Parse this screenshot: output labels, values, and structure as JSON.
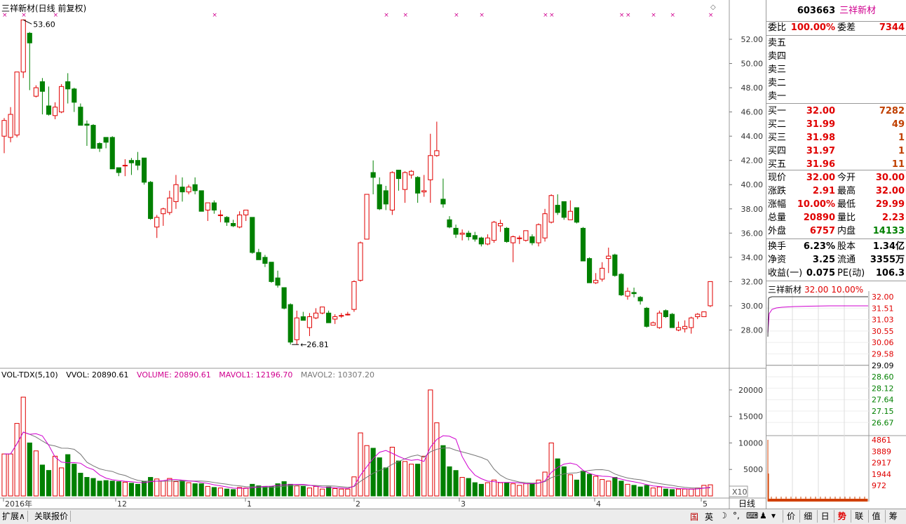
{
  "stock": {
    "code": "603663",
    "name": "三祥新材",
    "chart_title": "三祥新材(日线 前复权)",
    "period_label": "日线",
    "mult_label": "X10"
  },
  "chart_data": {
    "type": "candlestick",
    "price_axis": {
      "min": 26,
      "max": 53.6,
      "ticks": [
        "52.00",
        "50.00",
        "48.00",
        "46.00",
        "44.00",
        "42.00",
        "40.00",
        "38.00",
        "36.00",
        "34.00",
        "32.00",
        "30.00",
        "28.00"
      ]
    },
    "annotations": {
      "high": "53.60",
      "low": "26.81"
    },
    "x_labels": [
      "2016年",
      "12",
      "1",
      "2",
      "3",
      "4",
      "5"
    ],
    "candles": [
      [
        44.0,
        45.3,
        42.6,
        45.5
      ],
      [
        43.9,
        45.8,
        43.5,
        46.4
      ],
      [
        44.1,
        49.3,
        43.9,
        49.3
      ],
      [
        49.3,
        53.6,
        48.8,
        53.6
      ],
      [
        52.5,
        51.7,
        47.8,
        52.6
      ],
      [
        47.3,
        48.0,
        47.2,
        48.2
      ],
      [
        48.5,
        47.7,
        45.8,
        48.8
      ],
      [
        46.5,
        45.8,
        45.7,
        48.1
      ],
      [
        45.7,
        46.4,
        45.4,
        46.8
      ],
      [
        46.0,
        48.1,
        45.9,
        48.3
      ],
      [
        48.5,
        47.9,
        46.7,
        49.2
      ],
      [
        47.9,
        46.8,
        46.0,
        48.0
      ],
      [
        46.4,
        44.9,
        44.9,
        46.7
      ],
      [
        45.0,
        44.9,
        43.2,
        45.3
      ],
      [
        44.9,
        43.0,
        43.0,
        45.0
      ],
      [
        43.4,
        43.0,
        42.7,
        43.5
      ],
      [
        43.9,
        43.5,
        43.0,
        43.5
      ],
      [
        43.9,
        41.3,
        41.3,
        44.0
      ],
      [
        41.4,
        41.0,
        40.7,
        41.4
      ],
      [
        41.6,
        41.6,
        40.7,
        42.1
      ],
      [
        42.0,
        41.8,
        40.8,
        42.2
      ],
      [
        42.0,
        41.6,
        41.2,
        42.7
      ],
      [
        42.2,
        40.2,
        40.0,
        42.2
      ],
      [
        40.2,
        37.2,
        37.1,
        40.3
      ],
      [
        36.5,
        37.3,
        35.6,
        37.5
      ],
      [
        37.6,
        38.0,
        36.6,
        38.1
      ],
      [
        37.7,
        38.9,
        37.5,
        39.5
      ],
      [
        38.6,
        40.0,
        38.0,
        40.8
      ],
      [
        39.8,
        39.4,
        38.6,
        40.6
      ],
      [
        39.4,
        39.8,
        39.2,
        40.0
      ],
      [
        40.0,
        39.5,
        39.2,
        40.6
      ],
      [
        39.5,
        37.8,
        37.8,
        39.5
      ],
      [
        37.9,
        38.5,
        37.0,
        38.5
      ],
      [
        38.5,
        37.9,
        37.6,
        38.7
      ],
      [
        37.5,
        37.5,
        36.9,
        37.9
      ],
      [
        37.3,
        36.9,
        36.6,
        37.4
      ],
      [
        36.8,
        36.6,
        36.5,
        37.1
      ],
      [
        36.5,
        37.5,
        36.4,
        37.8
      ],
      [
        37.5,
        37.9,
        37.0,
        37.9
      ],
      [
        37.3,
        34.4,
        34.3,
        37.3
      ],
      [
        34.4,
        33.8,
        33.8,
        34.7
      ],
      [
        34.0,
        33.5,
        33.2,
        34.2
      ],
      [
        33.6,
        32.0,
        31.9,
        33.6
      ],
      [
        32.3,
        31.7,
        31.5,
        32.9
      ],
      [
        31.5,
        29.8,
        29.7,
        31.5
      ],
      [
        30.1,
        27.0,
        26.8,
        30.2
      ],
      [
        27.2,
        29.0,
        26.8,
        29.6
      ],
      [
        29.1,
        28.8,
        28.8,
        29.5
      ],
      [
        28.2,
        29.1,
        27.5,
        29.4
      ],
      [
        29.0,
        29.4,
        28.9,
        29.8
      ],
      [
        29.4,
        29.9,
        29.3,
        29.9
      ],
      [
        29.4,
        28.6,
        28.6,
        29.6
      ],
      [
        28.9,
        29.1,
        28.5,
        29.3
      ],
      [
        29.2,
        29.2,
        29.0,
        29.4
      ],
      [
        29.3,
        29.3,
        29.2,
        29.5
      ],
      [
        29.7,
        32.0,
        29.5,
        32.1
      ],
      [
        32.1,
        35.2,
        32.0,
        35.3
      ],
      [
        35.5,
        39.2,
        35.5,
        39.2
      ],
      [
        41.0,
        40.6,
        39.2,
        42.0
      ],
      [
        40.0,
        38.0,
        37.9,
        40.6
      ],
      [
        39.5,
        38.4,
        37.9,
        39.9
      ],
      [
        37.9,
        41.0,
        37.5,
        41.1
      ],
      [
        41.2,
        40.5,
        39.5,
        41.2
      ],
      [
        39.6,
        41.0,
        38.5,
        41.1
      ],
      [
        40.8,
        41.1,
        40.5,
        41.2
      ],
      [
        40.6,
        39.3,
        38.5,
        40.7
      ],
      [
        39.4,
        39.5,
        39.0,
        40.8
      ],
      [
        40.4,
        42.4,
        38.5,
        44.2
      ],
      [
        42.4,
        42.8,
        42.3,
        45.2
      ],
      [
        38.8,
        38.4,
        38.1,
        40.5
      ],
      [
        37.1,
        36.5,
        36.4,
        37.4
      ],
      [
        36.4,
        35.9,
        35.6,
        36.7
      ],
      [
        35.9,
        36.0,
        35.4,
        36.3
      ],
      [
        36.0,
        35.7,
        35.4,
        36.2
      ],
      [
        35.8,
        35.5,
        35.3,
        36.1
      ],
      [
        35.6,
        35.1,
        34.9,
        35.7
      ],
      [
        35.1,
        35.6,
        35.0,
        35.9
      ],
      [
        35.4,
        36.9,
        35.2,
        37.0
      ],
      [
        36.6,
        36.8,
        36.1,
        37.1
      ],
      [
        36.4,
        35.3,
        35.2,
        36.5
      ],
      [
        35.2,
        35.7,
        33.6,
        35.8
      ],
      [
        35.6,
        35.6,
        35.1,
        35.8
      ],
      [
        35.4,
        36.2,
        35.3,
        36.2
      ],
      [
        35.7,
        35.2,
        35.0,
        35.9
      ],
      [
        35.2,
        36.7,
        34.9,
        36.8
      ],
      [
        35.6,
        37.6,
        35.3,
        38.0
      ],
      [
        36.9,
        39.1,
        36.8,
        39.2
      ],
      [
        38.3,
        37.7,
        37.5,
        39.2
      ],
      [
        38.6,
        37.3,
        37.1,
        38.6
      ],
      [
        37.1,
        37.8,
        37.1,
        38.7
      ],
      [
        38.1,
        36.9,
        36.8,
        38.1
      ],
      [
        36.4,
        33.7,
        33.7,
        36.5
      ],
      [
        33.9,
        31.9,
        31.9,
        34.0
      ],
      [
        31.9,
        32.1,
        31.8,
        32.7
      ],
      [
        32.2,
        33.1,
        32.0,
        33.6
      ],
      [
        33.9,
        34.1,
        32.7,
        34.8
      ],
      [
        34.2,
        32.5,
        32.4,
        34.3
      ],
      [
        32.6,
        30.9,
        30.8,
        32.7
      ],
      [
        30.8,
        31.2,
        30.5,
        31.5
      ],
      [
        31.1,
        31.0,
        30.7,
        31.5
      ],
      [
        30.7,
        30.4,
        30.1,
        30.8
      ],
      [
        29.8,
        28.3,
        28.2,
        29.9
      ],
      [
        28.4,
        28.6,
        28.4,
        28.7
      ],
      [
        28.2,
        29.4,
        28.1,
        29.6
      ],
      [
        29.6,
        29.1,
        29.0,
        29.7
      ],
      [
        29.3,
        28.2,
        28.2,
        29.4
      ],
      [
        28.0,
        28.2,
        27.9,
        28.7
      ],
      [
        28.1,
        28.3,
        27.8,
        28.8
      ],
      [
        28.2,
        29.0,
        27.7,
        29.1
      ],
      [
        29.1,
        29.3,
        28.9,
        29.4
      ],
      [
        29.1,
        29.5,
        29.2,
        29.5
      ],
      [
        30.0,
        32.0,
        29.9,
        32.0
      ]
    ],
    "volume_axis": {
      "max": 20000,
      "ticks": [
        "20000",
        "15000",
        "10000",
        "5000"
      ]
    },
    "volume": [
      7926,
      7921,
      13684,
      18645,
      10000,
      8500,
      5833,
      4813,
      7500,
      5300,
      7800,
      6000,
      4300,
      3500,
      3300,
      2800,
      2900,
      2800,
      2700,
      2600,
      2400,
      2200,
      2700,
      3500,
      3200,
      2800,
      3300,
      2700,
      2900,
      2500,
      2300,
      2300,
      1800,
      1600,
      1500,
      1300,
      1200,
      1600,
      1500,
      2200,
      1900,
      1800,
      1800,
      2300,
      2700,
      2200,
      1900,
      1800,
      1500,
      1800,
      1300,
      1700,
      1400,
      1300,
      1300,
      3600,
      11900,
      9500,
      9000,
      7200,
      5300,
      9200,
      6600,
      6500,
      6000,
      6000,
      7500,
      20000,
      13800,
      9500,
      5500,
      4800,
      3500,
      3300,
      2500,
      2200,
      2500,
      3000,
      2500,
      2500,
      2300,
      2000,
      2300,
      2400,
      3000,
      4500,
      10000,
      7000,
      5500,
      4000,
      3000,
      4700,
      4100,
      3700,
      3100,
      2800,
      3500,
      2800,
      2200,
      2000,
      1700,
      2000,
      1500,
      1700,
      1300,
      1200,
      1300,
      1300,
      1300,
      1500,
      2000,
      2100
    ],
    "volume_header": {
      "indicator": "VOL-TDX(5,10)",
      "vvol": "VVOL: 20890.61",
      "volume": "VOLUME: 20890.61",
      "mavol1": "MAVOL1: 12196.70",
      "mavol2": "MAVOL2: 10307.20"
    }
  },
  "quote": {
    "weibi": "100.00%",
    "weicha": "7344",
    "sell": [
      {
        "label": "卖五"
      },
      {
        "label": "卖四"
      },
      {
        "label": "卖三"
      },
      {
        "label": "卖二"
      },
      {
        "label": "卖一"
      }
    ],
    "buy": [
      {
        "label": "买一",
        "price": "32.00",
        "vol": "7282"
      },
      {
        "label": "买二",
        "price": "31.99",
        "vol": "49"
      },
      {
        "label": "买三",
        "price": "31.98",
        "vol": "1"
      },
      {
        "label": "买四",
        "price": "31.97",
        "vol": "1"
      },
      {
        "label": "买五",
        "price": "31.96",
        "vol": "11"
      }
    ],
    "stats": [
      {
        "l1": "现价",
        "v1": "32.00",
        "c1": "red",
        "l2": "今开",
        "v2": "30.00",
        "c2": "red"
      },
      {
        "l1": "涨跌",
        "v1": "2.91",
        "c1": "red",
        "l2": "最高",
        "v2": "32.00",
        "c2": "red"
      },
      {
        "l1": "涨幅",
        "v1": "10.00%",
        "c1": "red",
        "l2": "最低",
        "v2": "29.99",
        "c2": "red"
      },
      {
        "l1": "总量",
        "v1": "20890",
        "c1": "red",
        "l2": "量比",
        "v2": "2.23",
        "c2": "red"
      },
      {
        "l1": "外盘",
        "v1": "6757",
        "c1": "red",
        "l2": "内盘",
        "v2": "14133",
        "c2": "grn"
      }
    ],
    "fund": [
      {
        "l1": "换手",
        "v1": "6.23%",
        "l2": "股本",
        "v2": "1.34亿"
      },
      {
        "l1": "净资",
        "v1": "3.25",
        "l2": "流通",
        "v2": "3355万"
      },
      {
        "l1": "收益(一)",
        "v1": "0.075",
        "l2": "PE(动)",
        "v2": "106.3"
      }
    ],
    "labels": {
      "weibi": "委比",
      "weicha": "委差"
    }
  },
  "intraday": {
    "title_name": "三祥新材",
    "price": "32.00",
    "pct": "10.00%",
    "price_ticks": [
      "32.00",
      "31.51",
      "31.03",
      "30.55",
      "30.06",
      "29.58",
      "29.09",
      "28.60",
      "28.12",
      "27.64",
      "27.15",
      "26.67"
    ],
    "vol_ticks": [
      "4861",
      "3889",
      "2917",
      "1944",
      "972"
    ]
  },
  "bottom": {
    "left_tabs": [
      "扩展∧",
      "关联报价"
    ],
    "ime": [
      "国",
      "英"
    ],
    "right_tabs": [
      "价",
      "细",
      "日",
      "势",
      "联",
      "值",
      "筹"
    ],
    "active_tab": "势"
  }
}
